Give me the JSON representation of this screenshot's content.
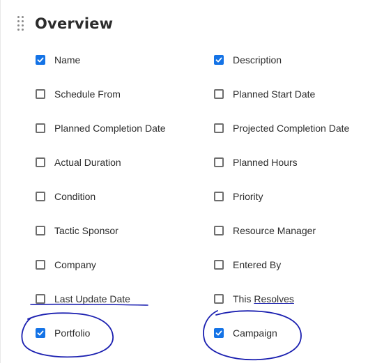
{
  "section": {
    "title": "Overview",
    "drag_handle_icon": "drag-handle-icon"
  },
  "fields": {
    "left": [
      {
        "label": "Name",
        "checked": true
      },
      {
        "label": "Schedule From",
        "checked": false
      },
      {
        "label": "Planned Completion Date",
        "checked": false
      },
      {
        "label": "Actual Duration",
        "checked": false
      },
      {
        "label": "Condition",
        "checked": false
      },
      {
        "label": "Tactic Sponsor",
        "checked": false
      },
      {
        "label": "Company",
        "checked": false
      },
      {
        "label": "Last Update Date",
        "checked": false
      },
      {
        "label": "Portfolio",
        "checked": true
      }
    ],
    "right": [
      {
        "label": "Description",
        "checked": true
      },
      {
        "label": "Planned Start Date",
        "checked": false
      },
      {
        "label": "Projected Completion Date",
        "checked": false
      },
      {
        "label": "Planned Hours",
        "checked": false
      },
      {
        "label": "Priority",
        "checked": false
      },
      {
        "label": "Resource Manager",
        "checked": false
      },
      {
        "label": "Entered By",
        "checked": false
      },
      {
        "label": "This Resolves",
        "label_part1": "This ",
        "label_part2": "Resolves",
        "checked": false
      },
      {
        "label": "Campaign",
        "checked": true
      }
    ]
  },
  "colors": {
    "checkbox_checked": "#1473e6",
    "checkbox_border": "#6e6e6e",
    "annotation_ink": "#1a1fb0"
  }
}
